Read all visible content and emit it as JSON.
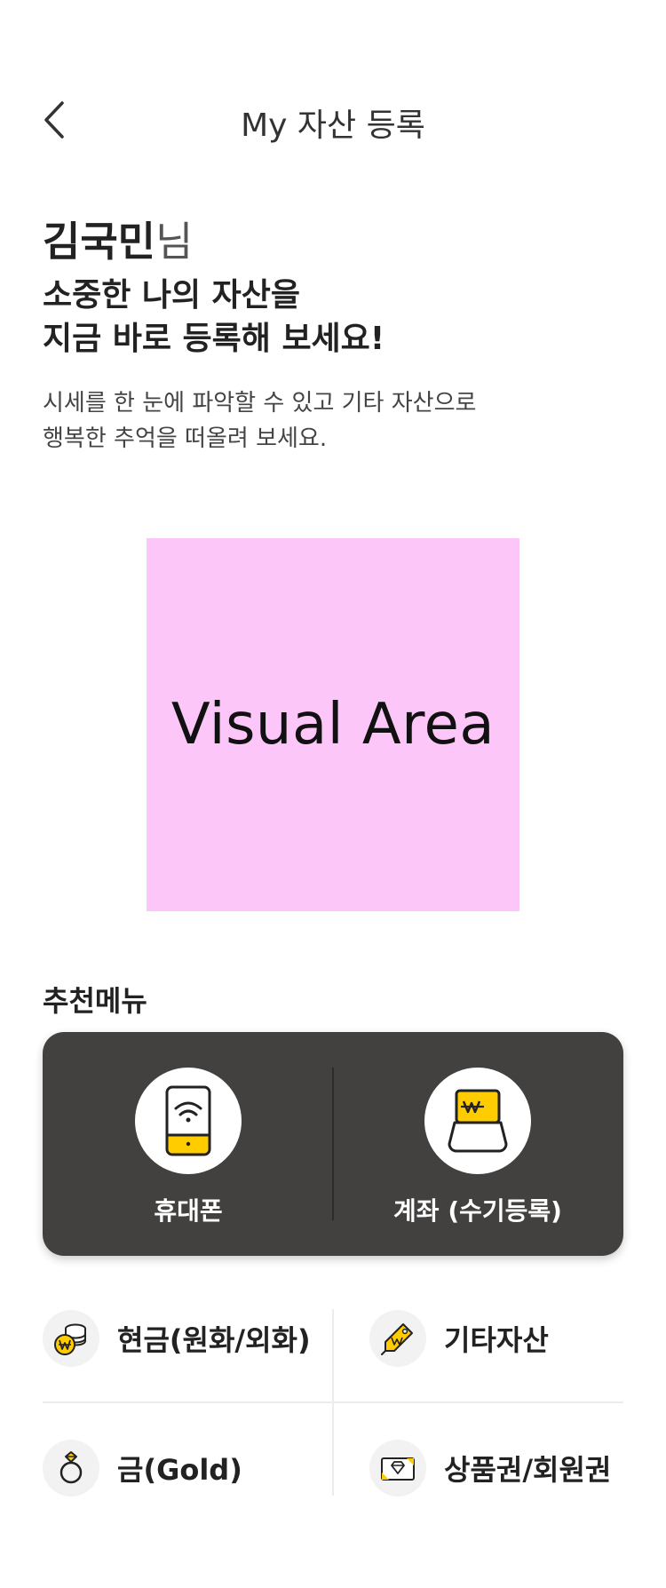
{
  "header": {
    "title": "My 자산 등록",
    "back_icon": "chevron-left-icon"
  },
  "greeting": {
    "name": "김국민",
    "suffix": "님"
  },
  "headline": {
    "line1": "소중한 나의 자산을",
    "line2": "지금 바로 등록해 보세요!"
  },
  "description": {
    "line1": "시세를 한 눈에 파악할 수 있고 기타 자산으로",
    "line2": "행복한 추억을 떠올려 보세요."
  },
  "visual": {
    "label": "Visual Area",
    "bg_color": "#fdc6f9"
  },
  "recommended": {
    "title": "추천메뉴",
    "card_color": "#424140",
    "accent_color": "#ffcc00",
    "items": [
      {
        "label": "휴대폰",
        "icon": "phone-wifi-icon"
      },
      {
        "label": "계좌 (수기등록)",
        "icon": "won-wallet-icon"
      }
    ]
  },
  "assets": [
    {
      "label": "현금(원화/외화)",
      "icon": "coins-icon"
    },
    {
      "label": "기타자산",
      "icon": "tag-icon"
    },
    {
      "label": "금(Gold)",
      "icon": "ring-icon"
    },
    {
      "label": "상품권/회원권",
      "icon": "voucher-icon"
    }
  ]
}
